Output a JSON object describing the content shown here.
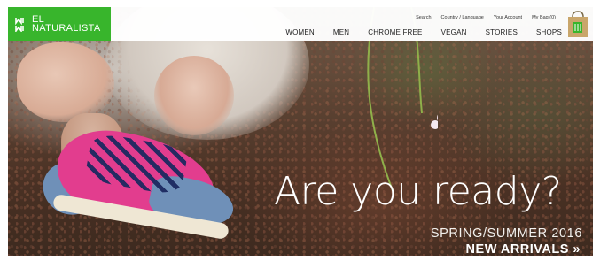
{
  "brand": {
    "name_line1": "EL",
    "name_line2": "NATURALISTA",
    "color": "#38b52c"
  },
  "utility_nav": [
    {
      "label": "Search"
    },
    {
      "label": "Country / Language"
    },
    {
      "label": "Your Account"
    },
    {
      "label": "My Bag (0)"
    }
  ],
  "main_nav": [
    {
      "label": "WOMEN"
    },
    {
      "label": "MEN"
    },
    {
      "label": "CHROME FREE"
    },
    {
      "label": "VEGAN"
    },
    {
      "label": "STORIES"
    },
    {
      "label": "SHOPS"
    }
  ],
  "hero": {
    "headline": "Are you ready?",
    "season": "SPRING/SUMMER 2016",
    "cta": "NEW ARRIVALS »"
  },
  "icons": {
    "logo": "brand-logo-icon",
    "bag": "shopping-bag-icon"
  }
}
